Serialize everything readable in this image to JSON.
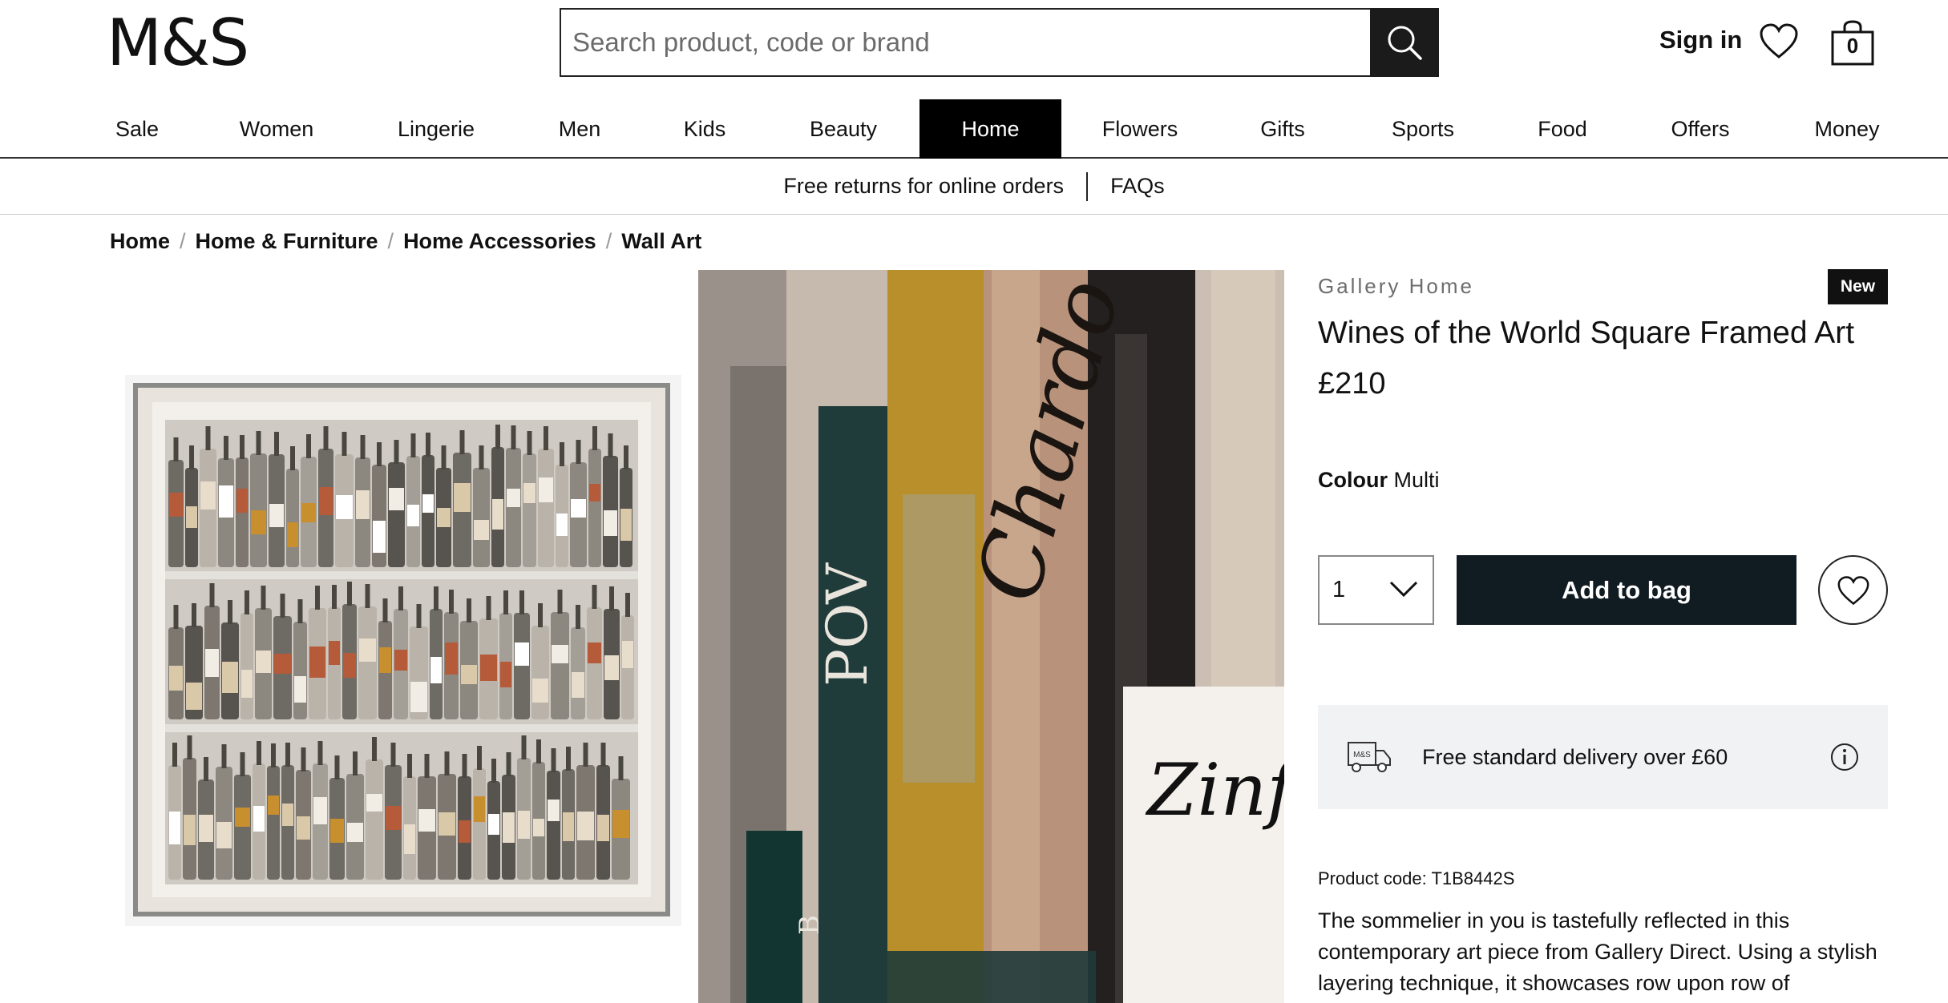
{
  "header": {
    "logo": "M&S",
    "search_placeholder": "Search product, code or brand",
    "sign_in": "Sign in",
    "bag_count": "0"
  },
  "nav": {
    "items": [
      "Sale",
      "Women",
      "Lingerie",
      "Men",
      "Kids",
      "Beauty",
      "Home",
      "Flowers",
      "Gifts",
      "Sports",
      "Food",
      "Offers",
      "Money"
    ],
    "active": "Home"
  },
  "promo": {
    "returns": "Free returns for online orders",
    "faqs": "FAQs"
  },
  "breadcrumb": [
    "Home",
    "Home & Furniture",
    "Home Accessories",
    "Wall Art"
  ],
  "product": {
    "brand": "Gallery Home",
    "badge": "New",
    "title": "Wines of the World Square Framed Art",
    "price": "£210",
    "colour_label": "Colour",
    "colour_value": "Multi",
    "quantity": "1",
    "add_to_bag": "Add to bag",
    "delivery_text": "Free standard delivery over £60",
    "delivery_icon_text": "M&S",
    "product_code": "Product code: T1B8442S",
    "description": "The sommelier in you is tastefully reflected in this contemporary art piece from Gallery Direct. Using a stylish layering technique, it showcases row upon row of"
  },
  "artwork_text": [
    "POV",
    "Chardo",
    "Zinf",
    "B"
  ],
  "colors": {
    "nav_active_bg": "#000000",
    "add_to_bag_bg": "#111b22",
    "delivery_bg": "#f1f2f4",
    "brand_text": "#6d6d6d"
  },
  "icons": [
    "search-icon",
    "heart-icon",
    "bag-icon",
    "chevron-down-icon",
    "delivery-van-icon",
    "info-icon"
  ]
}
